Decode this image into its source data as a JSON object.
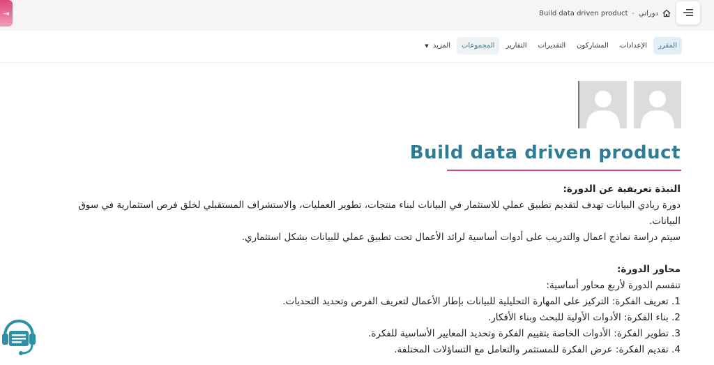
{
  "header": {
    "breadcrumb": {
      "current": "Build data driven product",
      "separator": "-",
      "parent": "دوراتي"
    }
  },
  "tabs": [
    {
      "label": "المقرر",
      "state": "active"
    },
    {
      "label": "الإعدادات"
    },
    {
      "label": "المشاركون"
    },
    {
      "label": "التقديرات"
    },
    {
      "label": "التقارير"
    },
    {
      "label": "المجموعات",
      "state": "highlight"
    },
    {
      "label": "المزيد"
    }
  ],
  "course": {
    "title": "Build data driven product",
    "intro_heading": "النبذة تعريفية عن الدورة:",
    "intro_line1": "دورة ريادي البيانات تهدف لتقديم تطبيق عملي للاستثمار في البيانات لبناء منتجات، تطوير العمليات، والاستشراف المستقبلي لخلق فرص استثمارية في سوق البيانات.",
    "intro_line2": "سيتم دراسة نماذج اعمال والتدريب على أدوات أساسية لرائد الأعمال تحت تطبيق عملي للبيانات بشكل استثماري.",
    "axes_heading": "محاور الدورة:",
    "axes_intro": "تنقسم الدورة لأربع محاور أساسية:",
    "axes": [
      "1. تعريف الفكرة: التركيز على المهارة التحليلية للبيانات بإطار الأعمال لتعريف الفرص وتحديد التحديات.",
      "2. بناء الفكرة: الأدوات الأولية للبحث وبناء الأفكار.",
      "3. تطوير الفكرة: الأدوات الخاصة بتقييم الفكرة وتحديد المعايير الأساسية للفكرة.",
      "4. تقديم الفكرة: عرض الفكرة للمستثمر والتعامل مع التساؤلات المختلفة."
    ]
  },
  "colors": {
    "accent": "#2f7d94",
    "underline": "#d9457c",
    "active_tab_bg": "#e3edf5"
  },
  "icons": {
    "menu": "hamburger-icon",
    "home": "home-icon",
    "drawer": "drawer-toggle-icon",
    "avatar": "user-placeholder-icon",
    "support": "headset-chat-icon"
  }
}
